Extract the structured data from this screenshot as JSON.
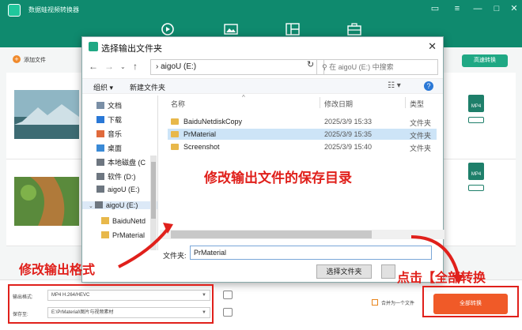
{
  "app": {
    "title": "数据蛙视频转换器",
    "add_file_label": "添加文件",
    "fast_convert_label": "高速转换",
    "format_badge": "MP4",
    "settings_label": "设置"
  },
  "dialog": {
    "title": "选择输出文件夹",
    "address": "aigoU (E:)",
    "search_placeholder": "在 aigoU (E:) 中搜索",
    "organize_label": "组织",
    "new_folder_label": "新建文件夹",
    "columns": {
      "name": "名称",
      "modified": "修改日期",
      "type": "类型"
    },
    "nav_items": [
      {
        "label": "文档",
        "icon": "document-icon"
      },
      {
        "label": "下载",
        "icon": "download-icon"
      },
      {
        "label": "音乐",
        "icon": "music-icon"
      },
      {
        "label": "桌面",
        "icon": "desktop-icon"
      },
      {
        "label": "本地磁盘 (C",
        "icon": "drive-icon"
      },
      {
        "label": "软件 (D:)",
        "icon": "drive-icon"
      },
      {
        "label": "aigoU (E:)",
        "icon": "drive-icon"
      },
      {
        "label": "aigoU (E:)",
        "icon": "usb-drive-icon"
      },
      {
        "label": "BaiduNetd",
        "icon": "folder-icon"
      },
      {
        "label": "PrMaterial",
        "icon": "folder-icon"
      }
    ],
    "files": [
      {
        "name": "BaiduNetdiskCopy",
        "modified": "2025/3/9 15:33",
        "type": "文件夹"
      },
      {
        "name": "PrMaterial",
        "modified": "2025/3/9 15:35",
        "type": "文件夹"
      },
      {
        "name": "Screenshot",
        "modified": "2025/3/9 15:40",
        "type": "文件夹"
      }
    ],
    "folder_field_label": "文件夹:",
    "folder_value": "PrMaterial",
    "select_folder_button": "选择文件夹"
  },
  "annotations": {
    "change_output_dir": "修改输出文件的保存目录",
    "change_output_format": "修改输出格式",
    "click_convert_all": "点击【全部转换"
  },
  "bottom": {
    "output_format_label": "输出格式:",
    "output_format_value": "MP4 H.264/HEVC",
    "save_to_label": "保存至:",
    "save_to_value": "E:\\PrMaterial\\图片与视频素材",
    "merge_label": "合并为一个文件",
    "convert_all_label": "全部转换"
  },
  "colors": {
    "brand_green": "#0f8a6e",
    "annotation_red": "#e0201b",
    "convert_orange": "#f05a28"
  }
}
